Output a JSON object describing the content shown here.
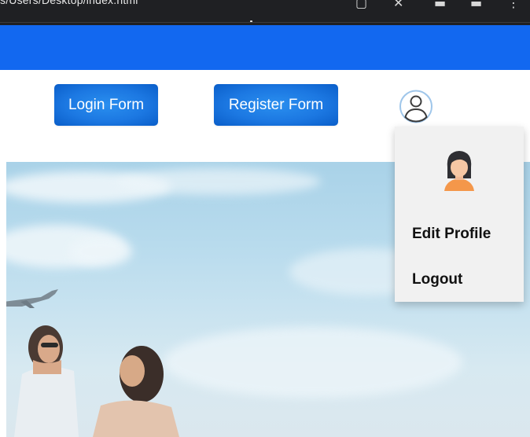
{
  "browser": {
    "url_text": "s/Users/Desktop/index.html"
  },
  "header": {
    "login_button_label": "Login Form",
    "register_button_label": "Register Form"
  },
  "profile_menu": {
    "items": [
      {
        "label": "Edit Profile"
      },
      {
        "label": "Logout"
      }
    ],
    "icons": {
      "toggle": "user-circle-icon",
      "avatar": "female-avatar-icon"
    }
  },
  "colors": {
    "nav_bar": "#1268f0",
    "button": "#1c78e2",
    "dropdown_bg": "#f1f1f1",
    "avatar_skin": "#f6c7a4",
    "avatar_hair": "#2f2f33",
    "avatar_shirt": "#f4974a"
  }
}
